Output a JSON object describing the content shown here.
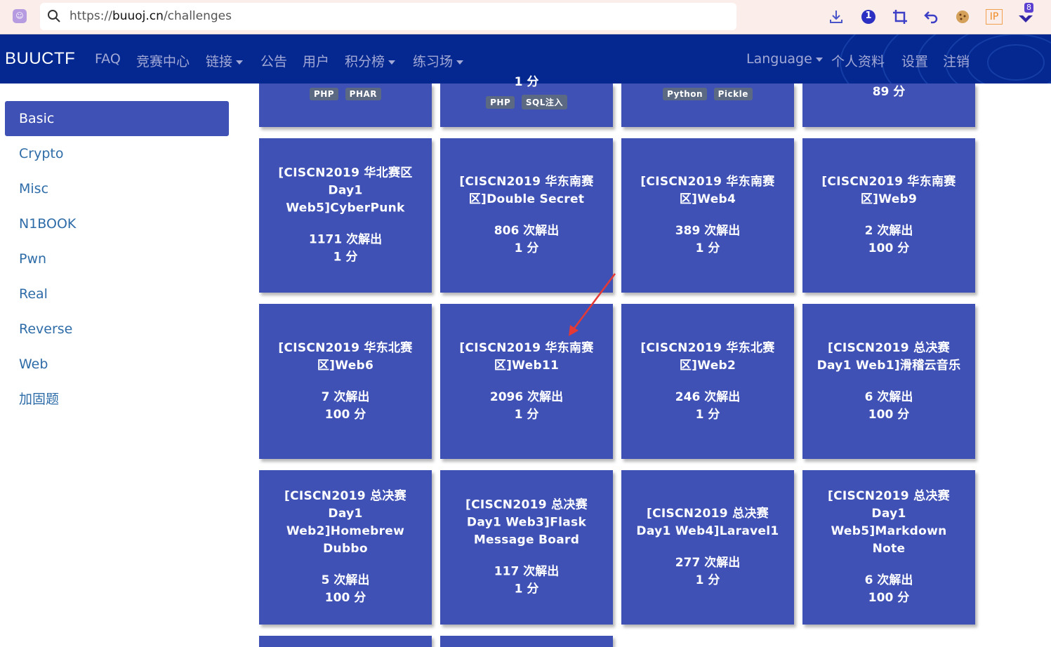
{
  "browser": {
    "url_prefix": "https://",
    "url_domain": "buuoj.cn",
    "url_path": "/challenges",
    "ext_badge_blue": "1",
    "ext_badge_download_count": "8",
    "ext_ip_label": "IP"
  },
  "navbar": {
    "brand": "BUUCTF",
    "left_items": [
      {
        "label": "FAQ",
        "dropdown": false
      },
      {
        "label": "竞赛中心",
        "dropdown": false
      },
      {
        "label": "链接",
        "dropdown": true
      },
      {
        "label": "公告",
        "dropdown": false
      },
      {
        "label": "用户",
        "dropdown": false
      },
      {
        "label": "积分榜",
        "dropdown": true
      },
      {
        "label": "练习场",
        "dropdown": true
      }
    ],
    "right_items": [
      {
        "label": "Language",
        "dropdown": true
      },
      {
        "label": "个人资料",
        "dropdown": false
      },
      {
        "label": "设置",
        "dropdown": false
      },
      {
        "label": "注销",
        "dropdown": false
      }
    ]
  },
  "sidebar": {
    "categories": [
      "Basic",
      "Crypto",
      "Misc",
      "N1BOOK",
      "Pwn",
      "Real",
      "Reverse",
      "Web",
      "加固题"
    ],
    "active": "Basic"
  },
  "top_row_partial": [
    {
      "tags": [
        "PHP",
        "PHAR"
      ]
    },
    {
      "score": "1 分",
      "tags": [
        "PHP",
        "SQL注入"
      ]
    },
    {
      "tags": [
        "Python",
        "Pickle"
      ]
    },
    {
      "score": "89 分"
    }
  ],
  "challenges": [
    {
      "title": "[CISCN2019 华北赛区 Day1 Web5]CyberPunk",
      "solves": "1171 次解出",
      "score": "1 分"
    },
    {
      "title": "[CISCN2019 华东南赛区]Double Secret",
      "solves": "806 次解出",
      "score": "1 分"
    },
    {
      "title": "[CISCN2019 华东南赛区]Web4",
      "solves": "389 次解出",
      "score": "1 分"
    },
    {
      "title": "[CISCN2019 华东南赛区]Web9",
      "solves": "2 次解出",
      "score": "100 分"
    },
    {
      "title": "[CISCN2019 华东北赛区]Web6",
      "solves": "7 次解出",
      "score": "100 分"
    },
    {
      "title": "[CISCN2019 华东南赛区]Web11",
      "solves": "2096 次解出",
      "score": "1 分"
    },
    {
      "title": "[CISCN2019 华东北赛区]Web2",
      "solves": "246 次解出",
      "score": "1 分"
    },
    {
      "title": "[CISCN2019 总决赛 Day1 Web1]滑稽云音乐",
      "solves": "6 次解出",
      "score": "100 分"
    },
    {
      "title": "[CISCN2019 总决赛 Day1 Web2]Homebrew Dubbo",
      "solves": "5 次解出",
      "score": "100 分"
    },
    {
      "title": "[CISCN2019 总决赛 Day1 Web3]Flask Message Board",
      "solves": "117 次解出",
      "score": "1 分"
    },
    {
      "title": "[CISCN2019 总决赛 Day1 Web4]Laravel1",
      "solves": "277 次解出",
      "score": "1 分"
    },
    {
      "title": "[CISCN2019 总决赛 Day1 Web5]Markdown Note",
      "solves": "6 次解出",
      "score": "100 分"
    }
  ],
  "colors": {
    "navbar_bg": "#04288f",
    "card_bg": "#3f51b5",
    "link": "#2e6ca8",
    "annotation_arrow": "#e53935"
  }
}
